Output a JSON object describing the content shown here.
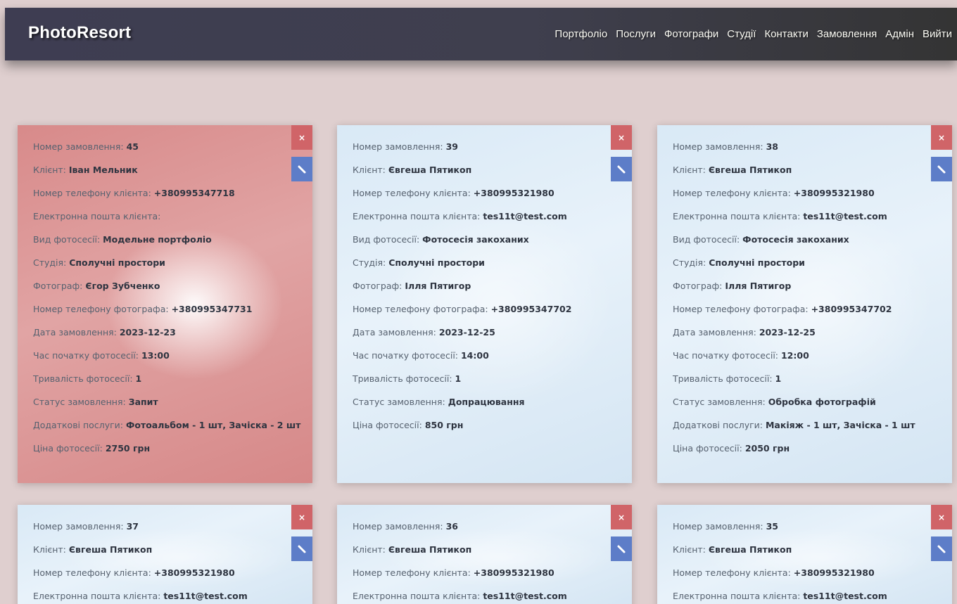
{
  "brand": "PhotoResort",
  "nav": [
    "Портфоліо",
    "Послуги",
    "Фотографи",
    "Студії",
    "Контакти",
    "Замовлення",
    "Адмін",
    "Вийти"
  ],
  "colors": {
    "navbar": "#3e3d52",
    "page_bg": "#dfcfcf",
    "delete_button": "#d06468",
    "edit_button": "#5d7dc8",
    "highlight_card": "#d88a8a",
    "card": "#e0edf8"
  },
  "icons": {
    "delete": "close-icon",
    "edit": "pencil-icon"
  },
  "orders": [
    {
      "highlight": true,
      "fields": [
        {
          "label": "Номер замовлення:",
          "value": "45"
        },
        {
          "label": "Клієнт:",
          "value": "Іван Мельник"
        },
        {
          "label": "Номер телефону клієнта:",
          "value": "+380995347718"
        },
        {
          "label": "Електронна пошта клієнта:",
          "value": ""
        },
        {
          "label": "Вид фотосесії:",
          "value": "Модельне портфоліо"
        },
        {
          "label": "Студія:",
          "value": "Сполучні простори"
        },
        {
          "label": "Фотограф:",
          "value": "Єгор Зубченко"
        },
        {
          "label": "Номер телефону фотографа:",
          "value": "+380995347731"
        },
        {
          "label": "Дата замовлення:",
          "value": "2023-12-23"
        },
        {
          "label": "Час початку фотосесії:",
          "value": "13:00"
        },
        {
          "label": "Тривалість фотосесії:",
          "value": "1"
        },
        {
          "label": "Статус замовлення:",
          "value": "Запит"
        },
        {
          "label": "Додаткові послуги:",
          "value": "Фотоальбом - 1 шт, Зачіска - 2 шт"
        },
        {
          "label": "Ціна фотосесії:",
          "value": "2750 грн"
        }
      ]
    },
    {
      "highlight": false,
      "fields": [
        {
          "label": "Номер замовлення:",
          "value": "39"
        },
        {
          "label": "Клієнт:",
          "value": "Євгеша Пятикоп"
        },
        {
          "label": "Номер телефону клієнта:",
          "value": "+380995321980"
        },
        {
          "label": "Електронна пошта клієнта:",
          "value": "tes11t@test.com"
        },
        {
          "label": "Вид фотосесії:",
          "value": "Фотосесія закоханих"
        },
        {
          "label": "Студія:",
          "value": "Сполучні простори"
        },
        {
          "label": "Фотограф:",
          "value": "Ілля Пятигор"
        },
        {
          "label": "Номер телефону фотографа:",
          "value": "+380995347702"
        },
        {
          "label": "Дата замовлення:",
          "value": "2023-12-25"
        },
        {
          "label": "Час початку фотосесії:",
          "value": "14:00"
        },
        {
          "label": "Тривалість фотосесії:",
          "value": "1"
        },
        {
          "label": "Статус замовлення:",
          "value": "Допрацювання"
        },
        {
          "label": "Ціна фотосесії:",
          "value": "850 грн"
        }
      ]
    },
    {
      "highlight": false,
      "fields": [
        {
          "label": "Номер замовлення:",
          "value": "38"
        },
        {
          "label": "Клієнт:",
          "value": "Євгеша Пятикоп"
        },
        {
          "label": "Номер телефону клієнта:",
          "value": "+380995321980"
        },
        {
          "label": "Електронна пошта клієнта:",
          "value": "tes11t@test.com"
        },
        {
          "label": "Вид фотосесії:",
          "value": "Фотосесія закоханих"
        },
        {
          "label": "Студія:",
          "value": "Сполучні простори"
        },
        {
          "label": "Фотограф:",
          "value": "Ілля Пятигор"
        },
        {
          "label": "Номер телефону фотографа:",
          "value": "+380995347702"
        },
        {
          "label": "Дата замовлення:",
          "value": "2023-12-25"
        },
        {
          "label": "Час початку фотосесії:",
          "value": "12:00"
        },
        {
          "label": "Тривалість фотосесії:",
          "value": "1"
        },
        {
          "label": "Статус замовлення:",
          "value": "Обробка фотографій"
        },
        {
          "label": "Додаткові послуги:",
          "value": "Макіяж - 1 шт, Зачіска - 1 шт"
        },
        {
          "label": "Ціна фотосесії:",
          "value": "2050 грн"
        }
      ]
    },
    {
      "highlight": false,
      "fields": [
        {
          "label": "Номер замовлення:",
          "value": "37"
        },
        {
          "label": "Клієнт:",
          "value": "Євгеша Пятикоп"
        },
        {
          "label": "Номер телефону клієнта:",
          "value": "+380995321980"
        },
        {
          "label": "Електронна пошта клієнта:",
          "value": "tes11t@test.com"
        }
      ]
    },
    {
      "highlight": false,
      "fields": [
        {
          "label": "Номер замовлення:",
          "value": "36"
        },
        {
          "label": "Клієнт:",
          "value": "Євгеша Пятикоп"
        },
        {
          "label": "Номер телефону клієнта:",
          "value": "+380995321980"
        },
        {
          "label": "Електронна пошта клієнта:",
          "value": "tes11t@test.com"
        }
      ]
    },
    {
      "highlight": false,
      "fields": [
        {
          "label": "Номер замовлення:",
          "value": "35"
        },
        {
          "label": "Клієнт:",
          "value": "Євгеша Пятикоп"
        },
        {
          "label": "Номер телефону клієнта:",
          "value": "+380995321980"
        },
        {
          "label": "Електронна пошта клієнта:",
          "value": "tes11t@test.com"
        }
      ]
    }
  ]
}
